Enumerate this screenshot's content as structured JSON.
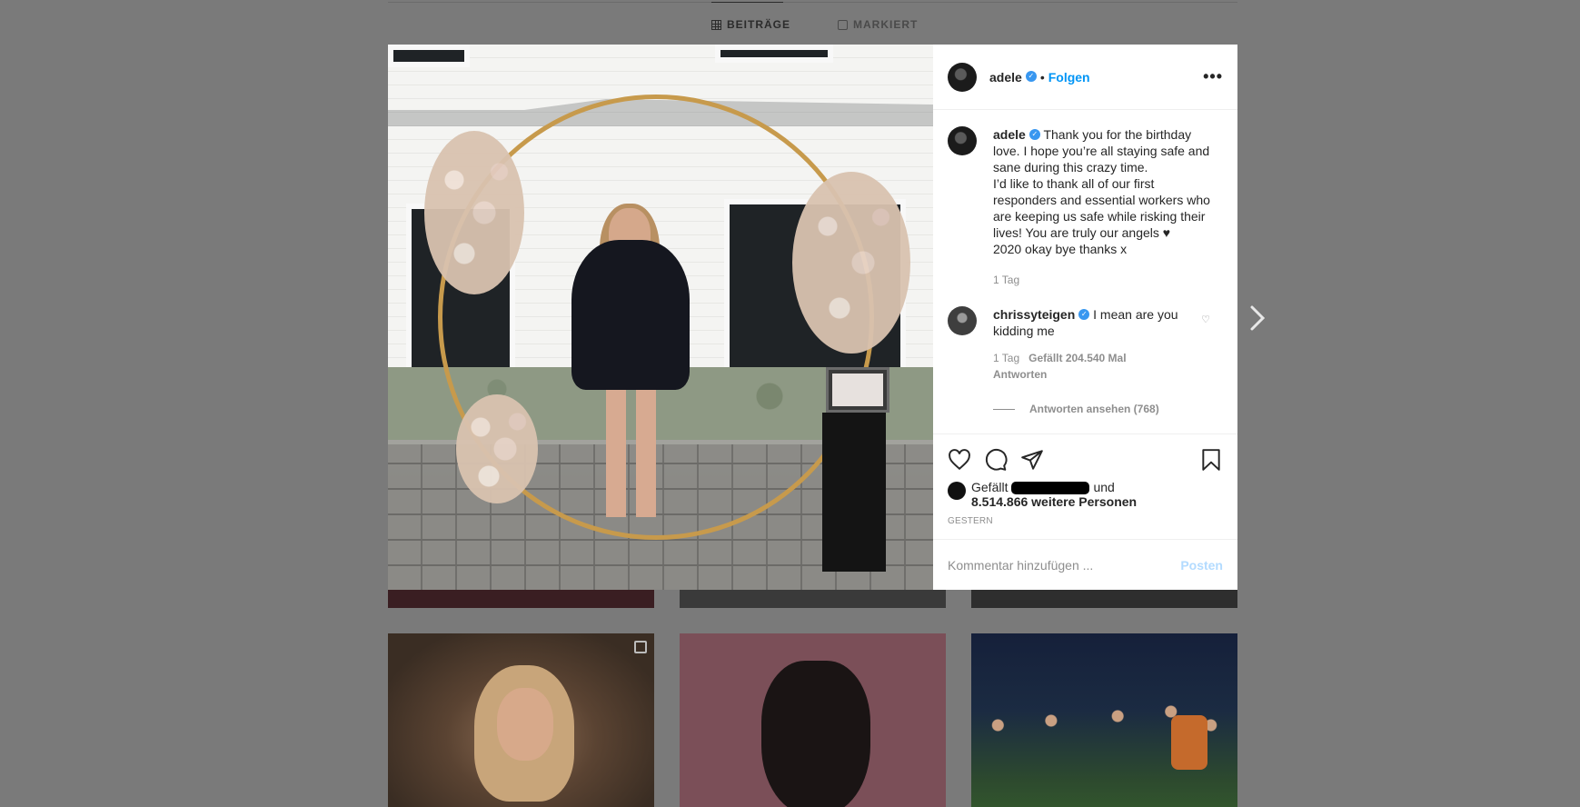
{
  "tabs": [
    {
      "label": "BEITRÄGE",
      "icon": "grid-icon",
      "active": true
    },
    {
      "label": "MARKIERT",
      "icon": "tag-icon",
      "active": false
    }
  ],
  "post": {
    "author": "adele",
    "follow_label": "Folgen",
    "separator": "•",
    "more_label": "•••",
    "caption_lines": [
      "Thank you for the birthday love. I hope you’re all staying safe and sane during this crazy time.",
      "I’d like to thank all of our first responders and essential workers who are keeping us safe while risking their lives! You are truly our angels ♥",
      "2020 okay bye thanks x"
    ],
    "caption_age": "1 Tag",
    "comments": [
      {
        "author": "chrissyteigen",
        "text": "I mean are you kidding me",
        "age": "1 Tag",
        "likes": "Gefällt 204.540 Mal",
        "reply_label": "Antworten",
        "view_replies": "Antworten ansehen (768)"
      }
    ],
    "likes_prefix": "Gefällt",
    "likes_and": "und",
    "likes_count_text": "8.514.866 weitere Personen",
    "date": "GESTERN",
    "comment_placeholder": "Kommentar hinzufügen ...",
    "post_label": "Posten"
  },
  "colors": {
    "accent": "#0095f6",
    "verified": "#3897f0",
    "post_disabled": "#b3dbff",
    "overlay_bg": "#7a7a7a"
  }
}
